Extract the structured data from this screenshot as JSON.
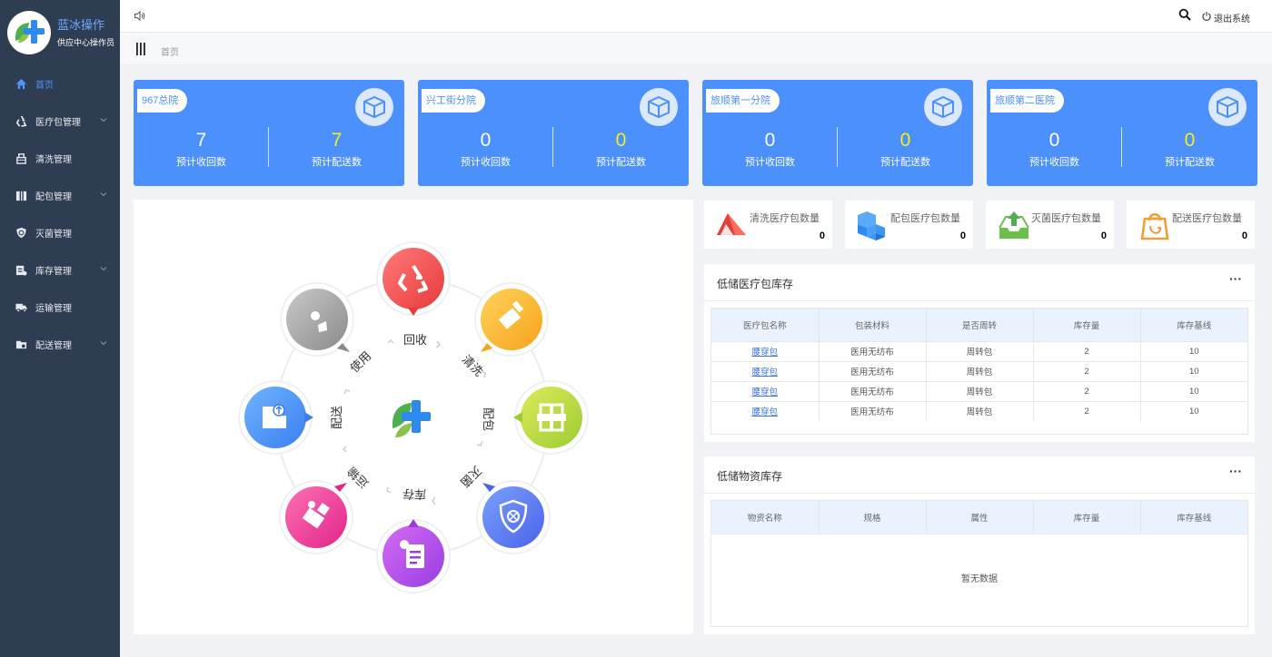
{
  "app": {
    "title": "蓝冰操作",
    "subtitle": "供应中心操作员"
  },
  "sidebar": {
    "items": [
      {
        "label": "首页",
        "icon": "home-icon",
        "active": true,
        "expandable": false
      },
      {
        "label": "医疗包管理",
        "icon": "recycle-icon",
        "expandable": true
      },
      {
        "label": "清洗管理",
        "icon": "wash-icon",
        "expandable": false
      },
      {
        "label": "配包管理",
        "icon": "package-icon",
        "expandable": true
      },
      {
        "label": "灭菌管理",
        "icon": "shield-icon",
        "expandable": false
      },
      {
        "label": "库存管理",
        "icon": "inventory-icon",
        "expandable": true
      },
      {
        "label": "运输管理",
        "icon": "truck-icon",
        "expandable": false
      },
      {
        "label": "配送管理",
        "icon": "delivery-icon",
        "expandable": true
      }
    ]
  },
  "header": {
    "logout": "退出系统"
  },
  "breadcrumb": {
    "current": "首页"
  },
  "hospitals": [
    {
      "name": "967总院",
      "recycle": "7",
      "deliver": "7",
      "recycle_label": "预计收回数",
      "deliver_label": "预计配送数"
    },
    {
      "name": "兴工街分院",
      "recycle": "0",
      "deliver": "0",
      "recycle_label": "预计收回数",
      "deliver_label": "预计配送数"
    },
    {
      "name": "旅顺第一分院",
      "recycle": "0",
      "deliver": "0",
      "recycle_label": "预计收回数",
      "deliver_label": "预计配送数"
    },
    {
      "name": "旅顺第二医院",
      "recycle": "0",
      "deliver": "0",
      "recycle_label": "预计收回数",
      "deliver_label": "预计配送数"
    }
  ],
  "process": {
    "steps": [
      "回收",
      "清洗",
      "配包",
      "灭菌",
      "库存",
      "运输",
      "配送",
      "使用"
    ]
  },
  "stats": [
    {
      "label": "清洗医疗包数量",
      "value": "0",
      "icon": "clean-package-icon"
    },
    {
      "label": "配包医疗包数量",
      "value": "0",
      "icon": "boxes-icon"
    },
    {
      "label": "灭菌医疗包数量",
      "value": "0",
      "icon": "sterilize-icon"
    },
    {
      "label": "配送医疗包数量",
      "value": "0",
      "icon": "delivery-bag-icon"
    }
  ],
  "low_package": {
    "title": "低储医疗包库存",
    "more": "···",
    "columns": [
      "医疗包名称",
      "包装材料",
      "是否周转",
      "库存量",
      "库存基线"
    ],
    "rows": [
      [
        "腰穿包",
        "医用无纺布",
        "周转包",
        "2",
        "10"
      ],
      [
        "腰穿包",
        "医用无纺布",
        "周转包",
        "2",
        "10"
      ],
      [
        "腰穿包",
        "医用无纺布",
        "周转包",
        "2",
        "10"
      ],
      [
        "腰穿包",
        "医用无纺布",
        "周转包",
        "2",
        "10"
      ]
    ]
  },
  "low_material": {
    "title": "低储物资库存",
    "more": "···",
    "columns": [
      "物资名称",
      "规格",
      "属性",
      "库存量",
      "库存基线"
    ],
    "empty_text": "暂无数据"
  },
  "colors": {
    "sidebar": "#2f3d52",
    "primary": "#4b90fc",
    "highlight": "#f3f01a"
  }
}
